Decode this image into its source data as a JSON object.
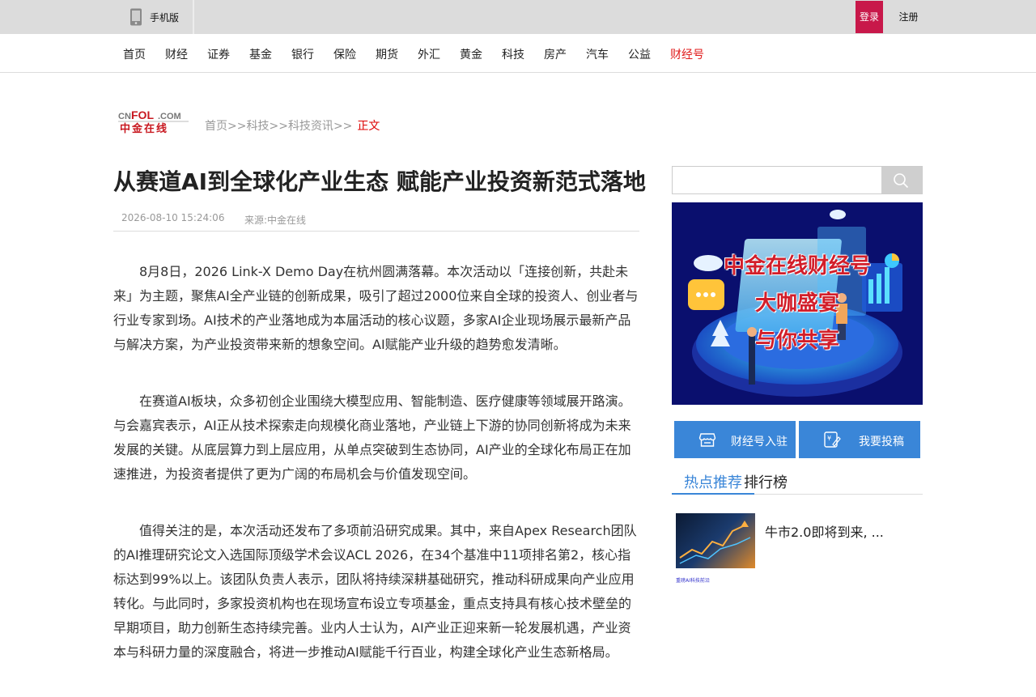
{
  "topbar": {
    "mobile_label": "手机版",
    "login": "登录",
    "register": "注册"
  },
  "nav": {
    "items": [
      "首页",
      "财经",
      "证券",
      "基金",
      "银行",
      "保险",
      "期货",
      "外汇",
      "黄金",
      "科技",
      "房产",
      "汽车",
      "公益"
    ],
    "highlight": "财经号"
  },
  "breadcrumb": {
    "logo_text": "CNFOL.COM 中金在线",
    "items": [
      "首页",
      ">>",
      "科技",
      ">>",
      "科技资讯",
      ">>"
    ],
    "current": "正文"
  },
  "article": {
    "title": "从赛道AI到全球化产业生态 赋能产业投资新范式落地",
    "date": "2026-08-10 15:24:06",
    "source": "来源:中金在线",
    "paragraphs": [
      "8月8日，2026 Link-X Demo Day在杭州圆满落幕。本次活动以「连接创新，共赴未来」为主题，聚焦AI全产业链的创新成果，吸引了超过2000位来自全球的投资人、创业者与行业专家到场。AI技术的产业落地成为本届活动的核心议题，多家AI企业现场展示最新产品与解决方案，为产业投资带来新的想象空间。AI赋能产业升级的趋势愈发清晰。",
      "在赛道AI板块，众多初创企业围绕大模型应用、智能制造、医疗健康等领域展开路演。与会嘉宾表示，AI正从技术探索走向规模化商业落地，产业链上下游的协同创新将成为未来发展的关键。从底层算力到上层应用，从单点突破到生态协同，AI产业的全球化布局正在加速推进，为投资者提供了更为广阔的布局机会与价值发现空间。",
      "值得关注的是，本次活动还发布了多项前沿研究成果。其中，来自Apex Research团队的AI推理研究论文入选国际顶级学术会议ACL 2026，在34个基准中11项排名第2，核心指标达到99%以上。该团队负责人表示，团队将持续深耕基础研究，推动科研成果向产业应用转化。与此同时，多家投资机构也在现场宣布设立专项基金，重点支持具有核心技术壁垒的早期项目，助力创新生态持续完善。业内人士认为，AI产业正迎来新一轮发展机遇，产业资本与科研力量的深度融合，将进一步推动AI赋能千行百业，构建全球化产业生态新格局。"
    ]
  },
  "sidebar": {
    "search_placeholder": "",
    "banner_lines": [
      "中金在线财经号",
      "大咖盛宴",
      "与你共享"
    ],
    "buttons": [
      "财经号入驻",
      "我要投稿"
    ],
    "tabs": [
      "热点推荐",
      "排行榜"
    ],
    "news": [
      {
        "title": "牛市2.0即将到来, ..."
      }
    ],
    "news2_thumb_text": "重磅AI科技前沿"
  },
  "colors": {
    "accent_red": "#c8184a",
    "accent_blue": "#3a86d8",
    "banner_bg": "#0a0f6e"
  }
}
